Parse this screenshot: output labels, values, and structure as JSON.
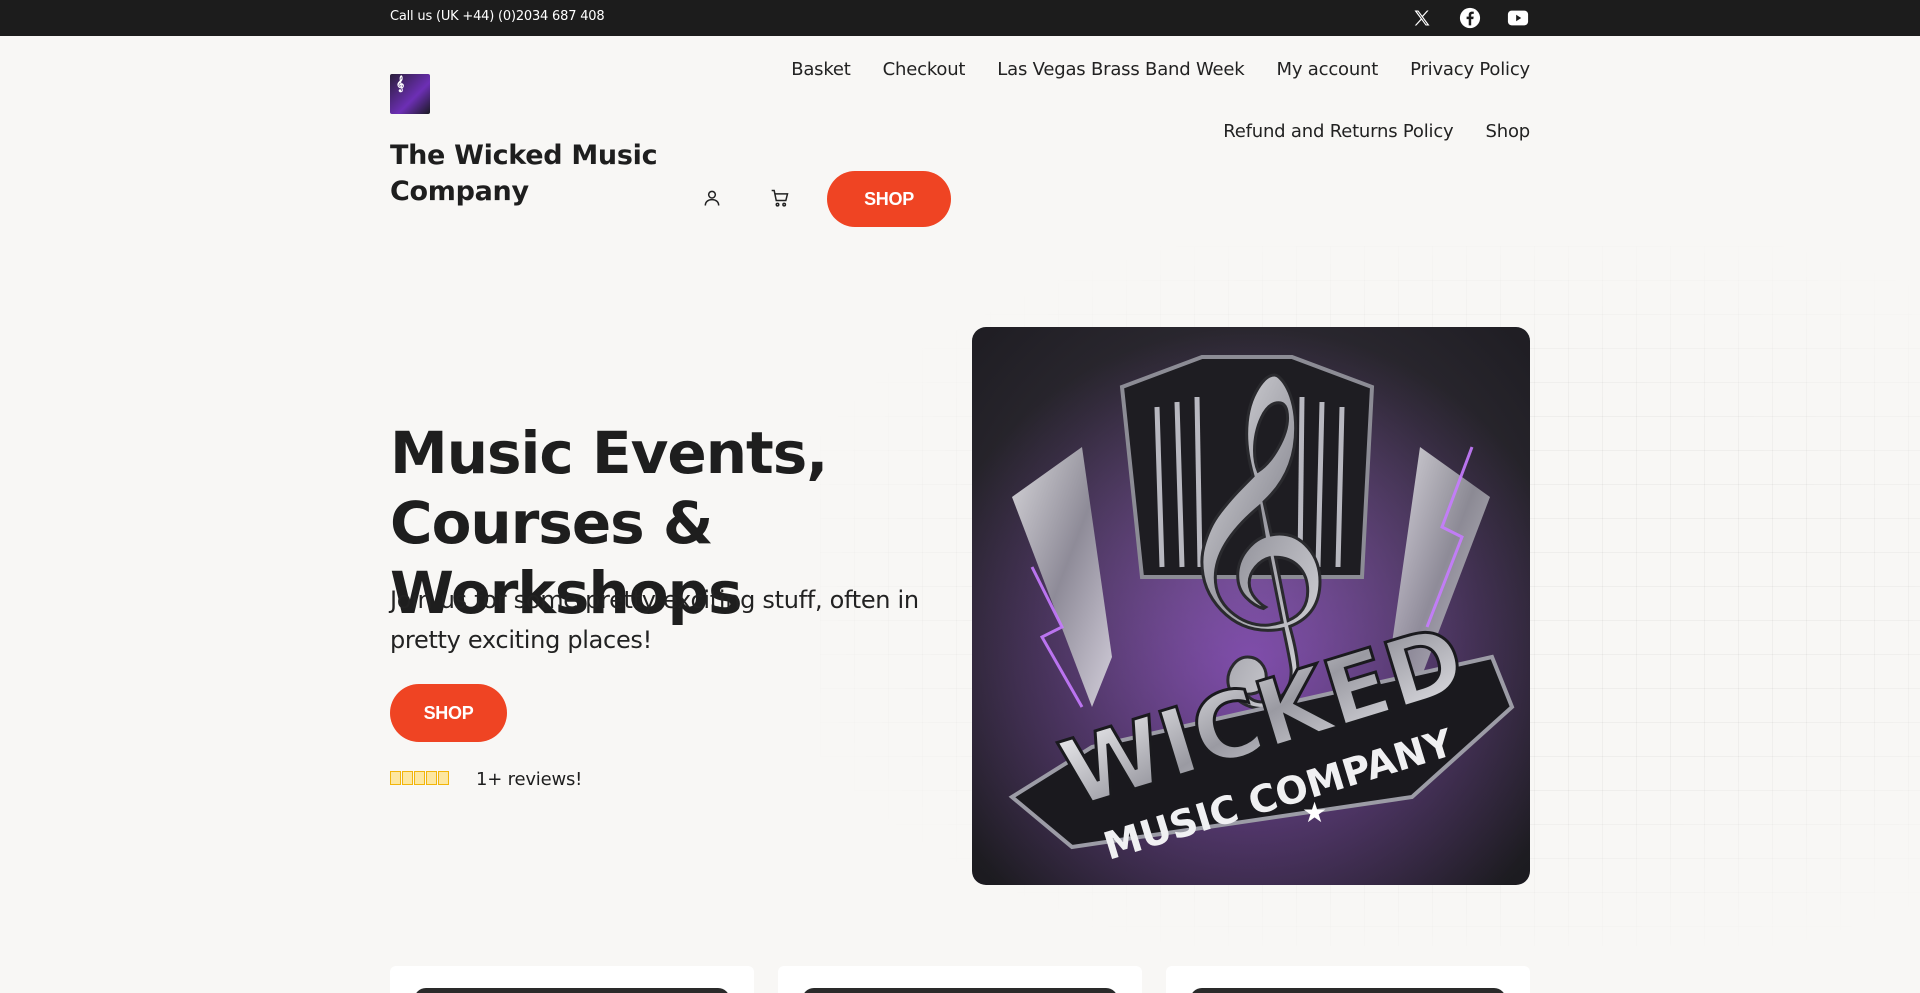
{
  "topbar": {
    "phone": "Call us (UK +44) (0)2034 687 408",
    "social_icons": [
      "x-twitter-icon",
      "facebook-icon",
      "youtube-icon"
    ]
  },
  "header": {
    "site_title": "The Wicked Music Company",
    "nav_row1": [
      "Basket",
      "Checkout",
      "Las Vegas Brass Band Week",
      "My account",
      "Privacy Policy"
    ],
    "nav_row2": [
      "Refund and Returns Policy",
      "Shop"
    ],
    "account_icon": "user-icon",
    "cart_icon": "cart-icon",
    "shop_button": "SHOP"
  },
  "hero": {
    "title": "Music Events, Courses & Workshops",
    "subtitle": "Join us for some pretty exciting stuff, often in pretty exciting places!",
    "shop_button": "SHOP",
    "rating_stars": 5,
    "reviews_text": "1+ reviews!",
    "image": {
      "line1": "WICKED",
      "line2": "MUSIC COMPANY"
    }
  },
  "colors": {
    "accent": "#ef4423",
    "topbar": "#1c1c1c",
    "background": "#f8f7f5",
    "star": "#f2b50a"
  }
}
